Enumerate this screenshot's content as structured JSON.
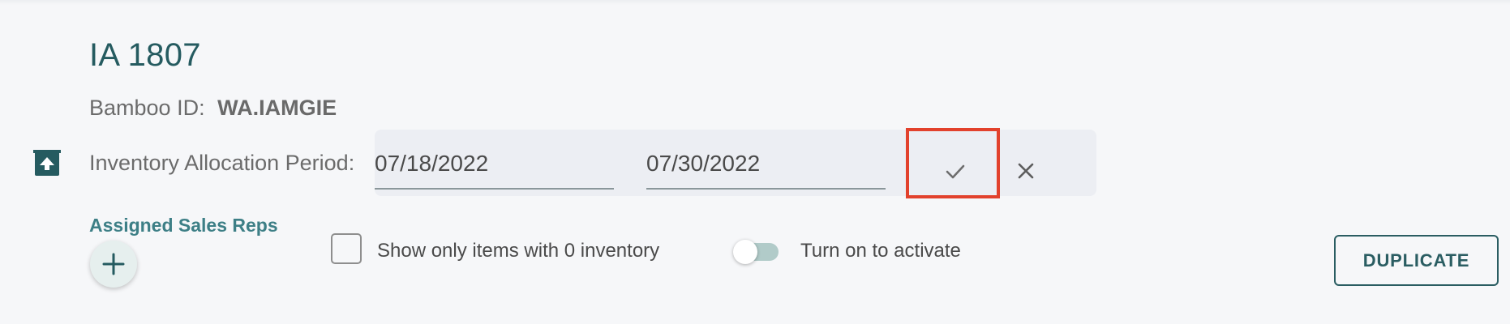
{
  "title": "IA 1807",
  "bamboo": {
    "label": "Bamboo ID:",
    "value": "WA.IAMGIE"
  },
  "period": {
    "label": "Inventory Allocation Period:",
    "start_date": "07/18/2022",
    "end_date": "07/30/2022",
    "confirm_icon": "check-icon",
    "cancel_icon": "close-icon"
  },
  "sales_reps": {
    "label": "Assigned Sales Reps",
    "add_icon": "plus-icon"
  },
  "filters": {
    "zero_inventory_label": "Show only items with 0 inventory",
    "zero_inventory_checked": false,
    "activate_label": "Turn on to activate",
    "activate_on": false
  },
  "actions": {
    "duplicate_label": "DUPLICATE"
  },
  "colors": {
    "accent": "#255b60",
    "highlight": "#e2412c",
    "toggle_track": "#b1cbc9"
  }
}
